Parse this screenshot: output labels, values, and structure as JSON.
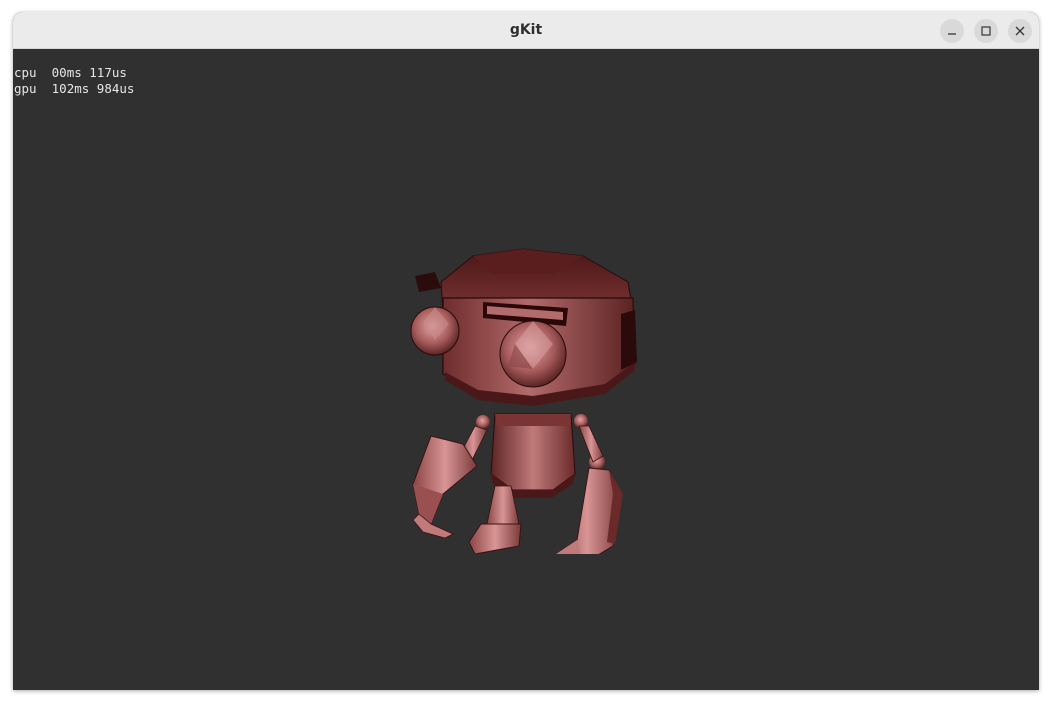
{
  "window": {
    "title": "gKit",
    "controls": {
      "minimize": "minimize-icon",
      "maximize": "maximize-icon",
      "close": "close-icon"
    }
  },
  "stats": {
    "cpu_label": "cpu",
    "cpu_value": "00ms 117us",
    "gpu_label": "gpu",
    "gpu_value": "102ms 984us"
  },
  "scene": {
    "background": "#303030",
    "model_color": "#a85c5c",
    "model": "robot-model"
  }
}
